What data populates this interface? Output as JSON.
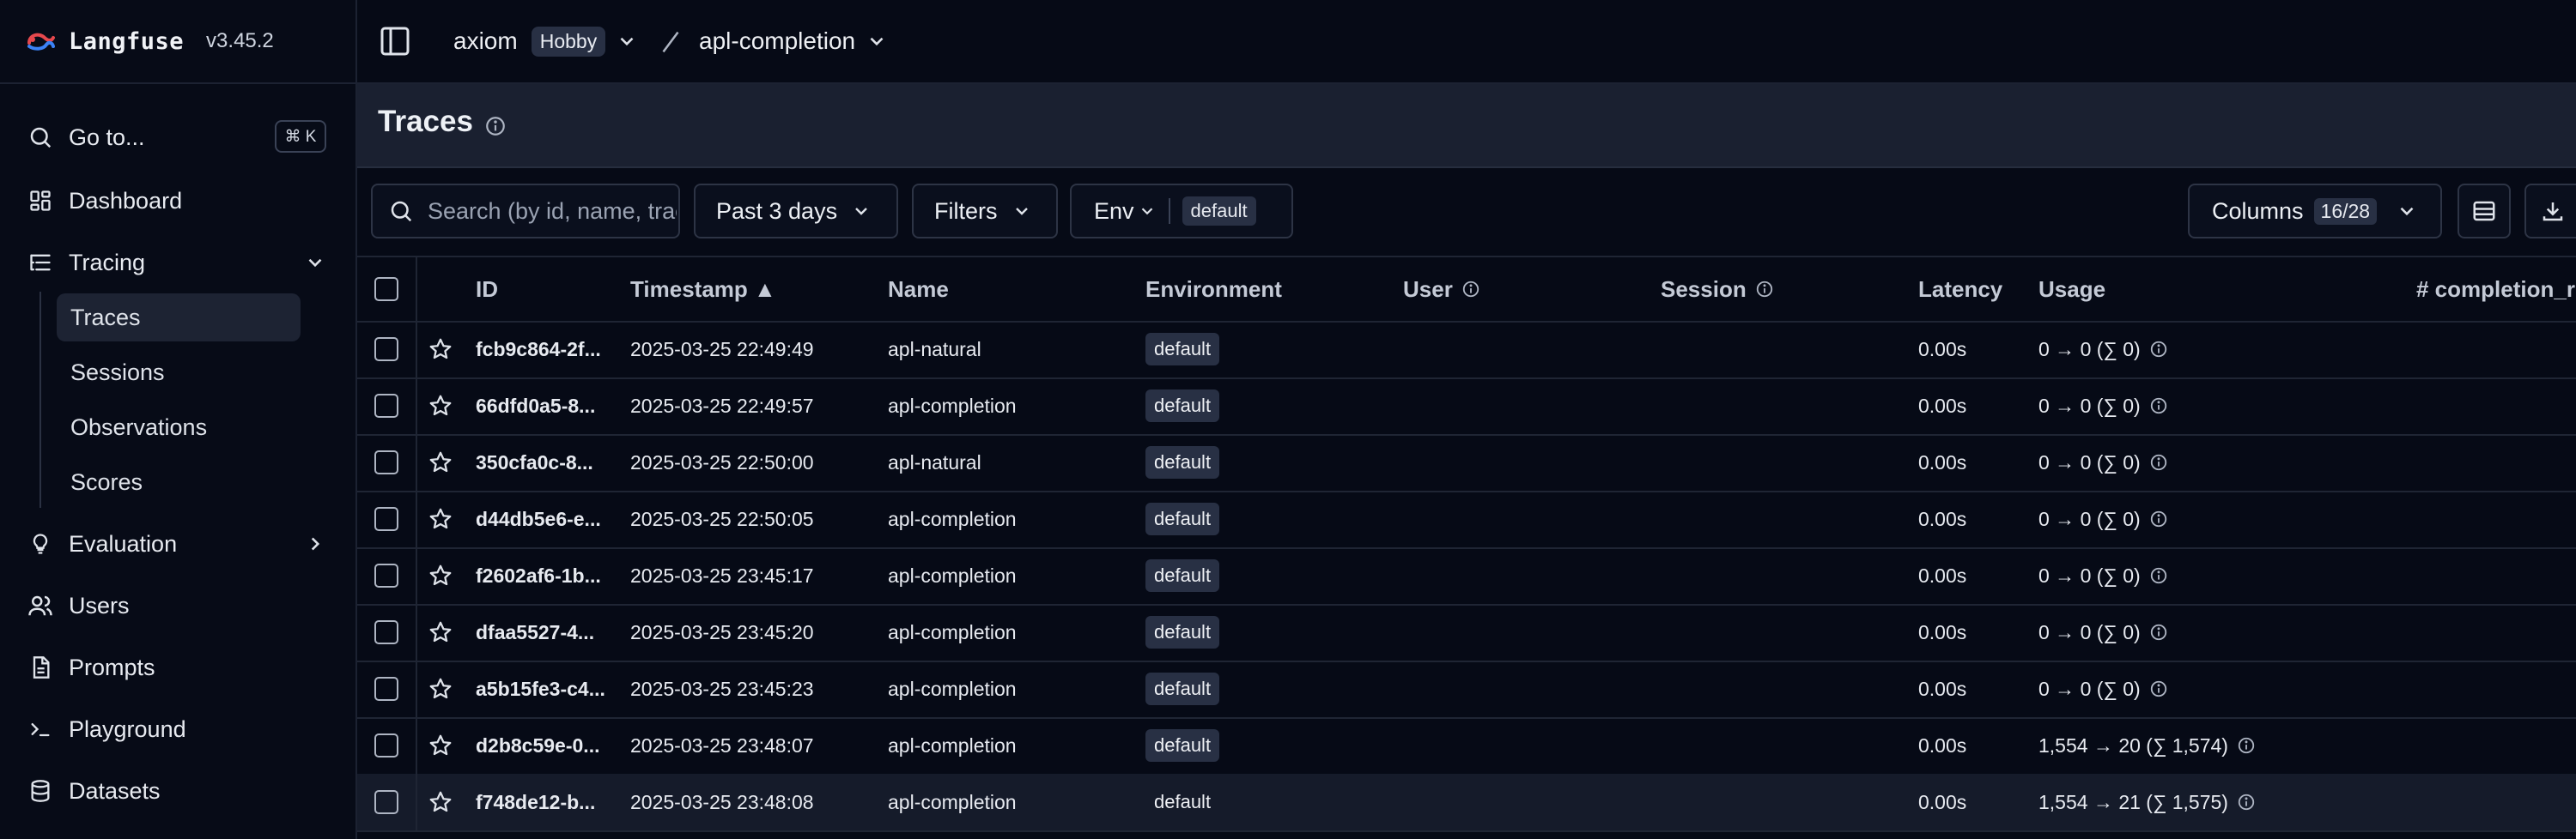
{
  "app": {
    "name": "Langfuse",
    "version": "v3.45.2"
  },
  "sidebar": {
    "goto": {
      "label": "Go to...",
      "shortcut": "⌘ K"
    },
    "items": [
      {
        "label": "Dashboard",
        "icon": "dashboard-icon"
      },
      {
        "label": "Tracing",
        "icon": "tracing-icon",
        "expanded": true
      },
      {
        "label": "Evaluation",
        "icon": "lightbulb-icon"
      },
      {
        "label": "Users",
        "icon": "users-icon"
      },
      {
        "label": "Prompts",
        "icon": "file-text-icon"
      },
      {
        "label": "Playground",
        "icon": "terminal-icon"
      },
      {
        "label": "Datasets",
        "icon": "database-icon"
      }
    ],
    "tracing_sub": [
      {
        "label": "Traces",
        "active": true
      },
      {
        "label": "Sessions"
      },
      {
        "label": "Observations"
      },
      {
        "label": "Scores"
      }
    ]
  },
  "topbar": {
    "org": "axiom",
    "plan": "Hobby",
    "project": "apl-completion"
  },
  "page": {
    "title": "Traces"
  },
  "toolbar": {
    "search_placeholder": "Search (by id, name, trace...",
    "time_range": "Past 3 days",
    "filters": "Filters",
    "env_label": "Env",
    "env_value": "default",
    "columns_label": "Columns",
    "columns_count": "16/28"
  },
  "table": {
    "headers": {
      "id": "ID",
      "timestamp": "Timestamp ▲",
      "name": "Name",
      "environment": "Environment",
      "user": "User",
      "session": "Session",
      "latency": "Latency",
      "usage": "Usage",
      "completion": "# completion_r"
    },
    "rows": [
      {
        "id": "fcb9c864-2f...",
        "timestamp": "2025-03-25 22:49:49",
        "name": "apl-natural",
        "env": "default",
        "latency": "0.00s",
        "usage": "0 → 0 (∑ 0)"
      },
      {
        "id": "66dfd0a5-8...",
        "timestamp": "2025-03-25 22:49:57",
        "name": "apl-completion",
        "env": "default",
        "latency": "0.00s",
        "usage": "0 → 0 (∑ 0)"
      },
      {
        "id": "350cfa0c-8...",
        "timestamp": "2025-03-25 22:50:00",
        "name": "apl-natural",
        "env": "default",
        "latency": "0.00s",
        "usage": "0 → 0 (∑ 0)"
      },
      {
        "id": "d44db5e6-e...",
        "timestamp": "2025-03-25 22:50:05",
        "name": "apl-completion",
        "env": "default",
        "latency": "0.00s",
        "usage": "0 → 0 (∑ 0)"
      },
      {
        "id": "f2602af6-1b...",
        "timestamp": "2025-03-25 23:45:17",
        "name": "apl-completion",
        "env": "default",
        "latency": "0.00s",
        "usage": "0 → 0 (∑ 0)"
      },
      {
        "id": "dfaa5527-4...",
        "timestamp": "2025-03-25 23:45:20",
        "name": "apl-completion",
        "env": "default",
        "latency": "0.00s",
        "usage": "0 → 0 (∑ 0)"
      },
      {
        "id": "a5b15fe3-c4...",
        "timestamp": "2025-03-25 23:45:23",
        "name": "apl-completion",
        "env": "default",
        "latency": "0.00s",
        "usage": "0 → 0 (∑ 0)"
      },
      {
        "id": "d2b8c59e-0...",
        "timestamp": "2025-03-25 23:48:07",
        "name": "apl-completion",
        "env": "default",
        "latency": "0.00s",
        "usage": "1,554 → 20 (∑ 1,574)"
      },
      {
        "id": "f748de12-b...",
        "timestamp": "2025-03-25 23:48:08",
        "name": "apl-completion",
        "env": "default",
        "latency": "0.00s",
        "usage": "1,554 → 21 (∑ 1,575)"
      }
    ]
  },
  "colors": {
    "background": "#060a16",
    "sidebar_active": "#1d2333",
    "pill": "#283044",
    "logo_red": "#e5484d",
    "logo_blue": "#3b82f6"
  }
}
